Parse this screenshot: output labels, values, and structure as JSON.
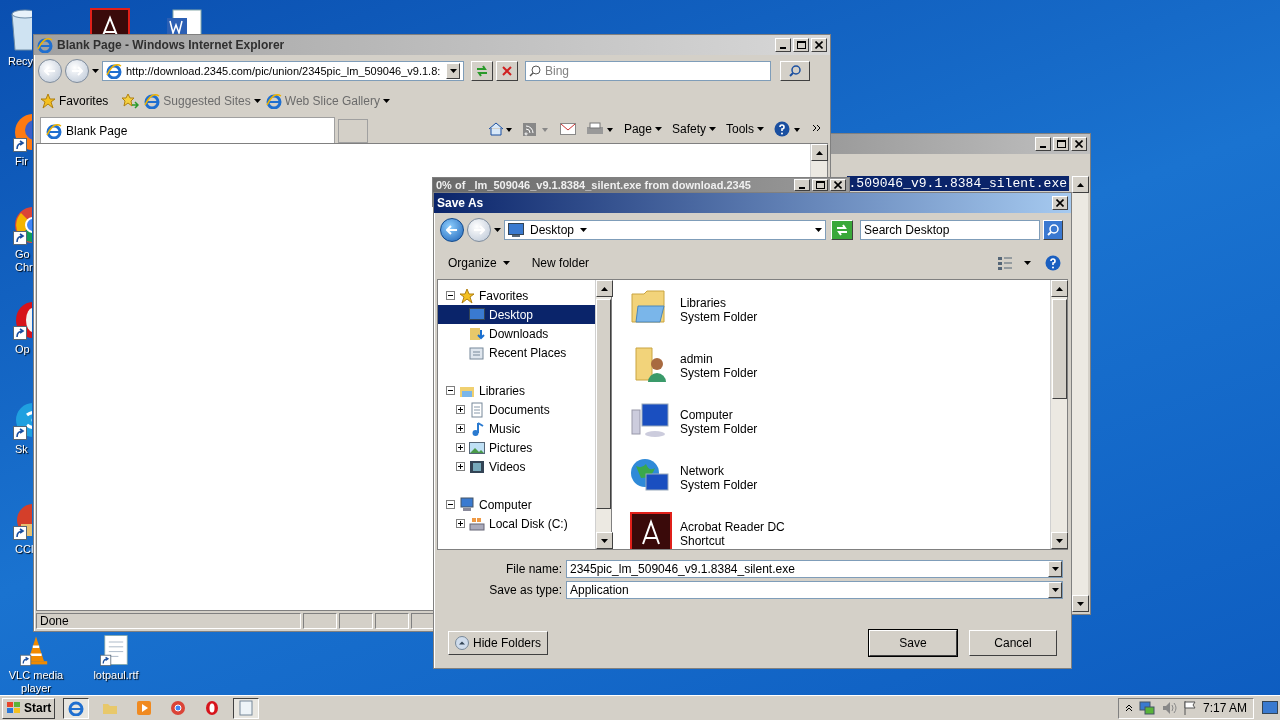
{
  "desktop": {
    "icons": [
      {
        "label": "Recy"
      },
      {
        "label": "Fir"
      },
      {
        "label": "Go Chr"
      },
      {
        "label": "Op"
      },
      {
        "label": "Sk"
      },
      {
        "label": "CCl"
      },
      {
        "label": "VLC media player"
      },
      {
        "label": "lotpaul.rtf"
      }
    ]
  },
  "back_window": {
    "selected_text": ".509046_v9.1.8384_silent.exe"
  },
  "ie_window": {
    "title": "Blank Page - Windows Internet Explorer",
    "address": "http://download.2345.com/pic/union/2345pic_lm_509046_v9.1.8:",
    "search": {
      "placeholder": "Bing"
    },
    "favorites_bar": [
      {
        "label": "Favorites"
      },
      {
        "label": "Suggested Sites"
      },
      {
        "label": "Web Slice Gallery"
      }
    ],
    "tabs": [
      {
        "label": "Blank Page",
        "selected": true
      }
    ],
    "commands": [
      "Page",
      "Safety",
      "Tools"
    ],
    "status_bar": "Done"
  },
  "download_dialog": {
    "title": "0% of _lm_509046_v9.1.8384_silent.exe from download.2345"
  },
  "save_as": {
    "title": "Save As",
    "location": "Desktop",
    "search": {
      "placeholder": "Search Desktop"
    },
    "toolbar": [
      "Organize",
      "New folder"
    ],
    "tree": [
      {
        "label": "Favorites",
        "expanded": true,
        "selected": false,
        "children": [
          {
            "label": "Desktop",
            "selected": true
          },
          {
            "label": "Downloads",
            "selected": false
          },
          {
            "label": "Recent Places",
            "selected": false
          }
        ]
      },
      {
        "label": "Libraries",
        "expanded": true,
        "selected": false,
        "children": [
          {
            "label": "Documents",
            "expanded": false,
            "selected": false
          },
          {
            "label": "Music",
            "expanded": false,
            "selected": false
          },
          {
            "label": "Pictures",
            "expanded": false,
            "selected": false
          },
          {
            "label": "Videos",
            "expanded": false,
            "selected": false
          }
        ]
      },
      {
        "label": "Computer",
        "expanded": true,
        "selected": false,
        "children": [
          {
            "label": "Local Disk (C:)",
            "expanded": false,
            "selected": false
          }
        ]
      }
    ],
    "items": [
      {
        "name": "Libraries",
        "type": "System Folder"
      },
      {
        "name": "admin",
        "type": "System Folder"
      },
      {
        "name": "Computer",
        "type": "System Folder"
      },
      {
        "name": "Network",
        "type": "System Folder"
      },
      {
        "name": "Acrobat Reader DC",
        "type": "Shortcut"
      }
    ],
    "file_name_label": "File name:",
    "file_name": "2345pic_lm_509046_v9.1.8384_silent.exe",
    "save_type_label": "Save as type:",
    "save_type": "Application",
    "buttons": [
      {
        "label": "Hide Folders",
        "kind": "toggle"
      },
      {
        "label": "Save",
        "kind": "default"
      },
      {
        "label": "Cancel",
        "kind": "plain"
      }
    ]
  },
  "taskbar": {
    "start": "Start",
    "clock": "7:17 AM"
  }
}
